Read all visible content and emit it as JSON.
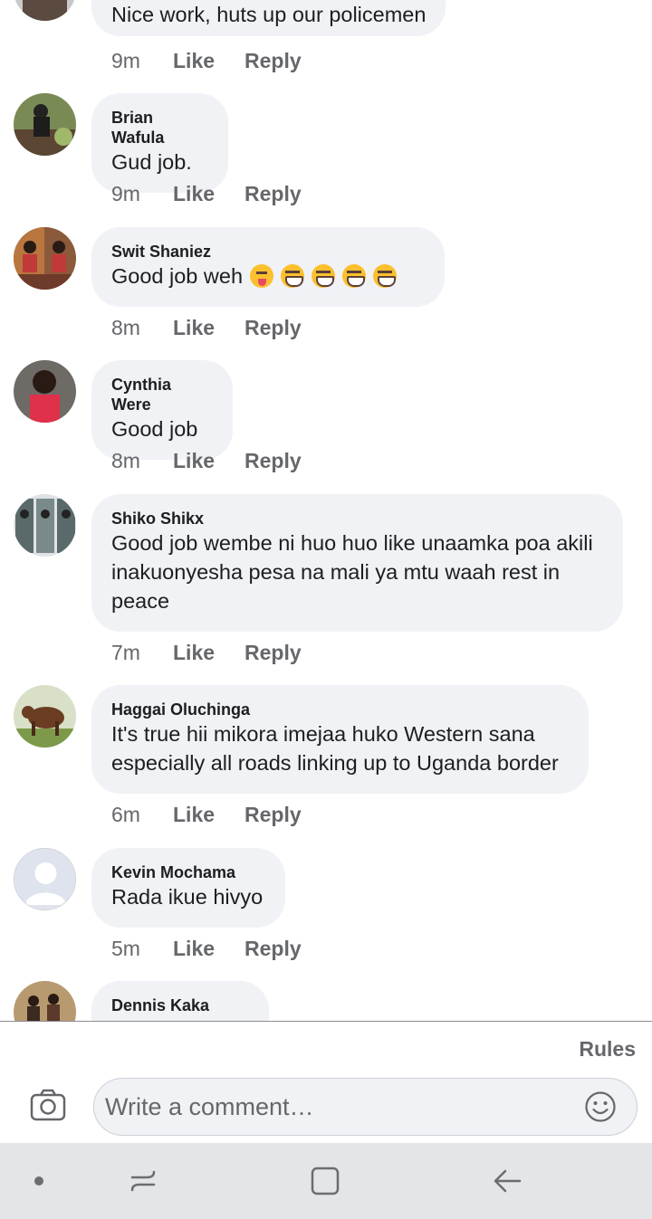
{
  "comments": [
    {
      "author": "",
      "text": "Nice work, huts up our policemen",
      "time": "9m",
      "like": "Like",
      "reply": "Reply"
    },
    {
      "author": "Brian Wafula",
      "text": "Gud job.",
      "time": "9m",
      "like": "Like",
      "reply": "Reply"
    },
    {
      "author": "Swit Shaniez",
      "text": "Good job weh",
      "time": "8m",
      "like": "Like",
      "reply": "Reply",
      "emojis": [
        "face-with-tongue",
        "grinning-squinting-face",
        "grinning-squinting-face",
        "grinning-squinting-face",
        "grinning-squinting-face"
      ]
    },
    {
      "author": "Cynthia Were",
      "text": "Good job",
      "time": "8m",
      "like": "Like",
      "reply": "Reply"
    },
    {
      "author": "Shiko Shikx",
      "text": "Good job wembe ni huo huo like unaamka poa akili inakuonyesha pesa na mali ya mtu waah rest in peace",
      "time": "7m",
      "like": "Like",
      "reply": "Reply"
    },
    {
      "author": "Haggai Oluchinga",
      "text": "It's true hii mikora imejaa huko Western sana especially all roads linking up to Uganda border",
      "time": "6m",
      "like": "Like",
      "reply": "Reply"
    },
    {
      "author": "Kevin Mochama",
      "text": "Rada ikue hivyo",
      "time": "5m",
      "like": "Like",
      "reply": "Reply"
    },
    {
      "author": "Dennis Kaka",
      "text": ""
    }
  ],
  "composer": {
    "rules_label": "Rules",
    "placeholder": "Write a comment…",
    "camera_icon": "camera-icon",
    "emoji_icon": "smiley-icon"
  },
  "navbar": {
    "items": [
      "dot-icon",
      "recents-icon",
      "home-square-icon",
      "back-arrow-icon"
    ]
  },
  "colors": {
    "bubble": "#f0f2f5",
    "meta_text": "#65676b",
    "navbar_bg": "#e4e5e7"
  }
}
